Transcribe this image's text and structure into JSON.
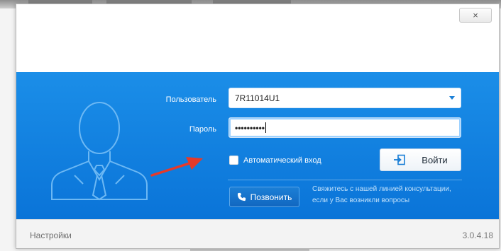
{
  "window": {
    "close_symbol": "×"
  },
  "form": {
    "username_label": "Пользователь",
    "username_value": "7R11014U1",
    "password_label": "Пароль",
    "password_value": "••••••••••",
    "auto_login_label": "Автоматический вход",
    "auto_login_checked": false,
    "login_button": "Войти"
  },
  "support": {
    "call_button": "Позвонить",
    "note_line1": "Свяжитесь с нашей линией консультации,",
    "note_line2": "если у Вас возникли вопросы"
  },
  "footer": {
    "settings_link": "Настройки",
    "version": "3.0.4.18"
  },
  "icons": {
    "avatar": "user-silhouette-icon",
    "login": "sign-in-icon",
    "phone": "phone-icon",
    "dropdown": "chevron-down-icon",
    "annotation": "red-arrow"
  },
  "colors": {
    "panel_blue": "#1b8ee8",
    "annotation_red": "#e53a2a"
  }
}
